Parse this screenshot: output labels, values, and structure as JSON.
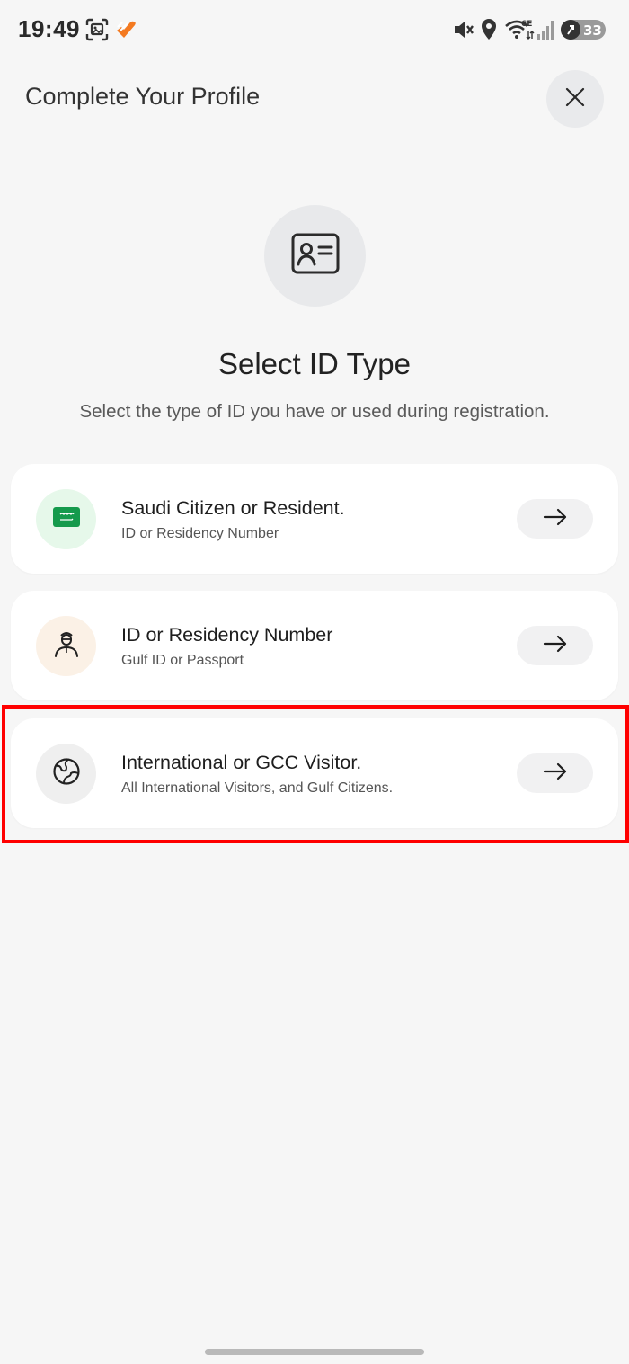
{
  "status_bar": {
    "time": "19:49",
    "battery": "33",
    "network": "6E",
    "icons": [
      "screenshot-icon",
      "app-notification-icon",
      "mute-icon",
      "location-icon",
      "wifi-icon",
      "signal-icon",
      "battery-icon"
    ]
  },
  "header": {
    "title": "Complete Your Profile",
    "close_icon": "close-icon"
  },
  "hero": {
    "icon": "id-card-icon",
    "title": "Select ID Type",
    "subtitle": "Select the type of ID you have or used during registration."
  },
  "options": [
    {
      "title": "Saudi Citizen or Resident.",
      "subtitle": "ID or Residency Number",
      "icon": "saudi-flag-icon",
      "icon_bg": "#e6f8ea",
      "icon_color": "#159a4c"
    },
    {
      "title": "ID or Residency Number",
      "subtitle": "Gulf ID or Passport",
      "icon": "person-icon",
      "icon_bg": "#fbf1e6",
      "icon_color": "#222222"
    },
    {
      "title": "International or GCC Visitor.",
      "subtitle": "All International Visitors, and Gulf Citizens.",
      "icon": "globe-icon",
      "icon_bg": "#efefef",
      "icon_color": "#222222"
    }
  ],
  "colors": {
    "background": "#f6f6f6",
    "card": "#ffffff",
    "highlight": "#ff0000",
    "accent_orange": "#f47a20"
  }
}
